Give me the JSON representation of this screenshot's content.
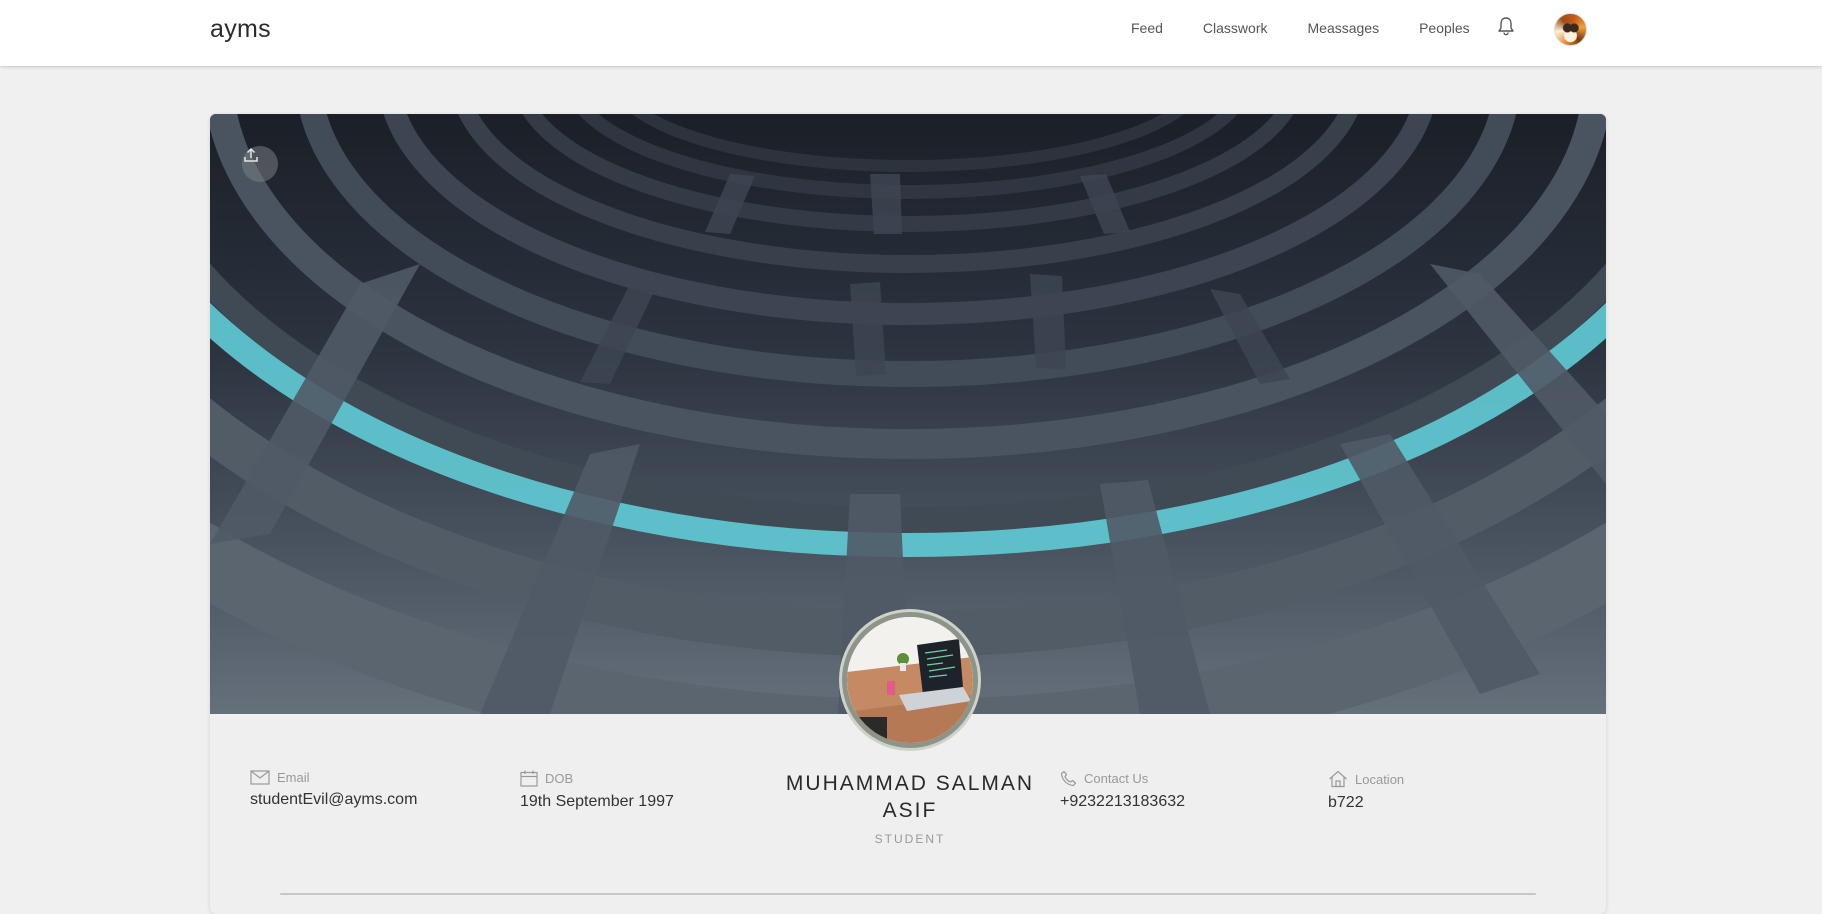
{
  "nav": {
    "brand": "ayms",
    "links": [
      "Feed",
      "Classwork",
      "Meassages",
      "Peoples"
    ],
    "bell_icon": "bell-icon",
    "avatar_icon": "user-avatar"
  },
  "profile": {
    "name": "MUHAMMAD SALMAN ASIF",
    "role": "STUDENT",
    "email": {
      "label": "Email",
      "value": "studentEvil@ayms.com",
      "icon": "mail-icon"
    },
    "dob": {
      "label": "DOB",
      "value": "19th September 1997",
      "icon": "calendar-icon"
    },
    "contact": {
      "label": "Contact Us",
      "value": "+9232213183632",
      "icon": "phone-icon"
    },
    "location": {
      "label": "Location",
      "value": "b722",
      "icon": "home-icon"
    }
  },
  "colors": {
    "accent": "#5fc9d3",
    "photo_ring": "#8d9489"
  }
}
